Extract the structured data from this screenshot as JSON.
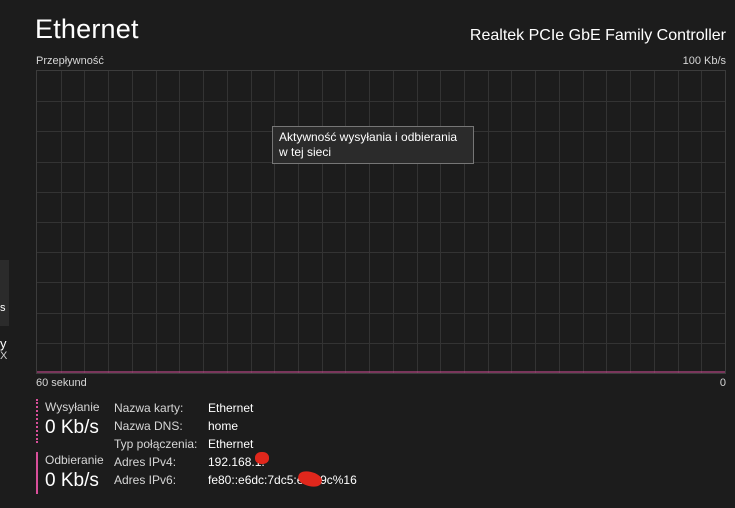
{
  "header": {
    "title": "Ethernet",
    "adapter": "Realtek PCIe GbE Family Controller"
  },
  "graph": {
    "y_label": "Przepływność",
    "y_max_label": "100 Kb/s",
    "x_left_label": "60 sekund",
    "x_right_label": "0",
    "tooltip": "Aktywność wysyłania i odbierania w tej sieci",
    "line_color": "#d94f9a"
  },
  "stats": {
    "send_label": "Wysyłanie",
    "send_value": "0 Kb/s",
    "recv_label": "Odbieranie",
    "recv_value": "0 Kb/s"
  },
  "details": [
    {
      "key": "Nazwa karty:",
      "value": "Ethernet"
    },
    {
      "key": "Nazwa DNS:",
      "value": "home"
    },
    {
      "key": "Typ połączenia:",
      "value": "Ethernet"
    },
    {
      "key": "Adres IPv4:",
      "value": "192.168.1."
    },
    {
      "key": "Adres IPv6:",
      "value": "fe80::e6dc:7dc5:e     a99c%16"
    }
  ],
  "sliver": {
    "s": "s",
    "y": "y",
    "x": "X"
  }
}
